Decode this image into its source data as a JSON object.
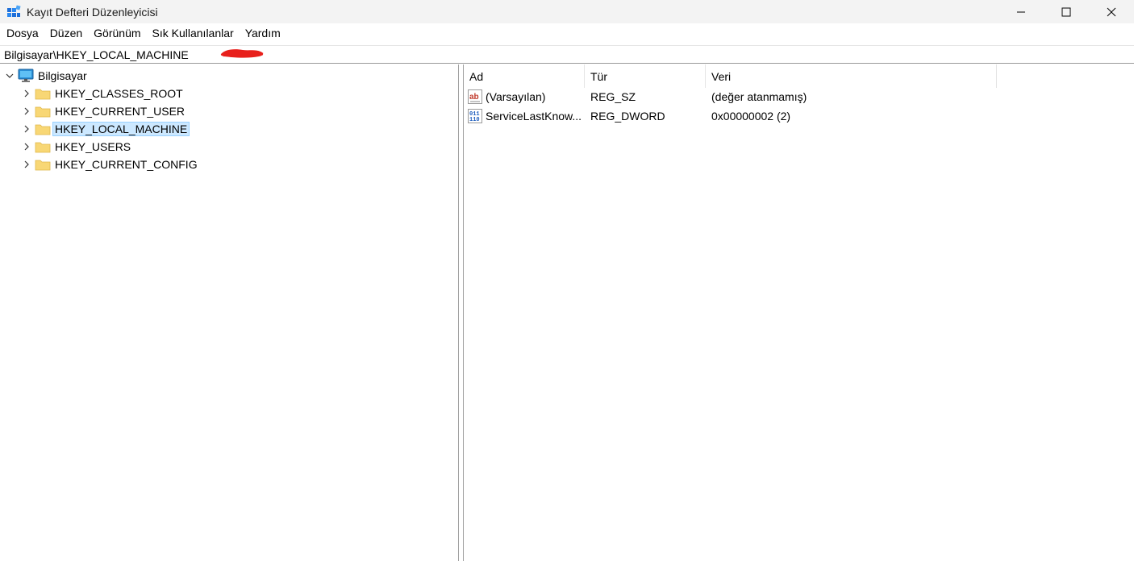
{
  "window": {
    "title": "Kayıt Defteri Düzenleyicisi",
    "icon": "regedit-icon"
  },
  "menu": [
    "Dosya",
    "Düzen",
    "Görünüm",
    "Sık Kullanılanlar",
    "Yardım"
  ],
  "address": "Bilgisayar\\HKEY_LOCAL_MACHINE",
  "tree": {
    "root": "Bilgisayar",
    "keys": [
      "HKEY_CLASSES_ROOT",
      "HKEY_CURRENT_USER",
      "HKEY_LOCAL_MACHINE",
      "HKEY_USERS",
      "HKEY_CURRENT_CONFIG"
    ],
    "selected": "HKEY_LOCAL_MACHINE"
  },
  "values": {
    "columns": [
      "Ad",
      "Tür",
      "Veri"
    ],
    "rows": [
      {
        "name": "(Varsayılan)",
        "type": "REG_SZ",
        "data": "(değer atanmamış)",
        "icon": "string-value-icon"
      },
      {
        "name": "ServiceLastKnow...",
        "type": "REG_DWORD",
        "data": "0x00000002 (2)",
        "icon": "binary-value-icon"
      }
    ]
  },
  "colors": {
    "selection_bg": "#cce8ff",
    "selection_border": "#99d1ff",
    "folder": "#f8d775",
    "redaction": "#e8201c"
  }
}
